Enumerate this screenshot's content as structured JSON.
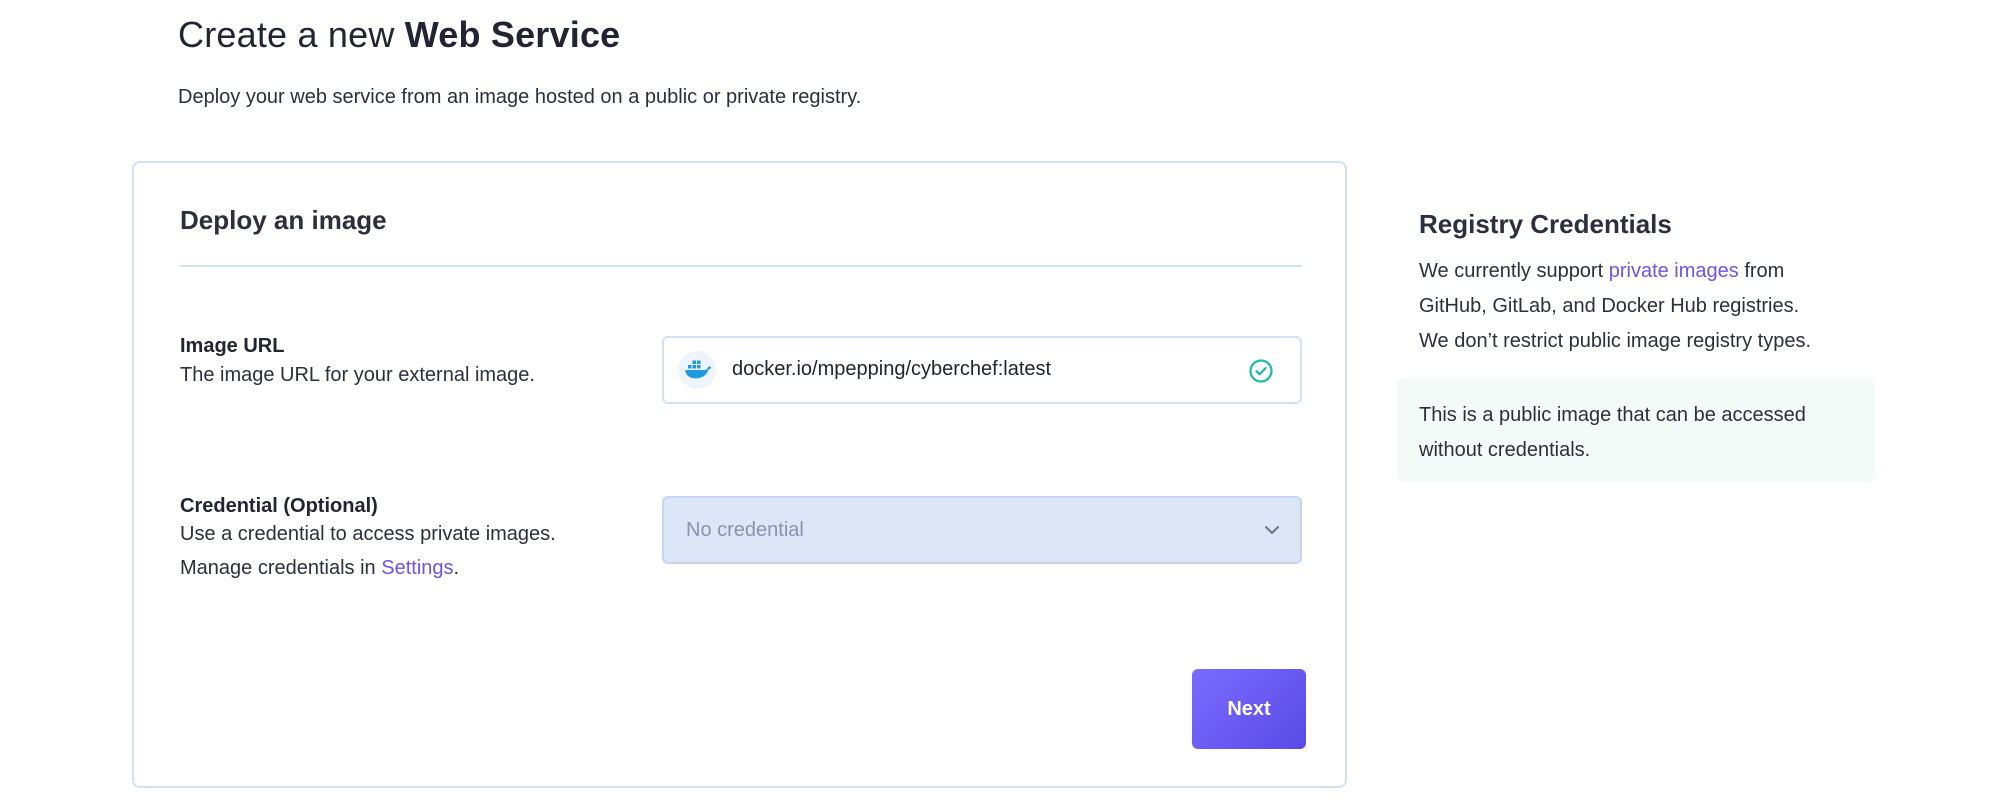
{
  "header": {
    "title_prefix": "Create a new",
    "title_bold": "Web Service",
    "subtitle": "Deploy your web service from an image hosted on a public or private registry."
  },
  "card": {
    "title": "Deploy an image",
    "image_url": {
      "label": "Image URL",
      "help": "The image URL for your external image.",
      "value": "docker.io/mpepping/cyberchef:latest",
      "icon": "docker-icon",
      "status_icon": "check-circle-icon"
    },
    "credential": {
      "label": "Credential (Optional)",
      "help_line1": "Use a credential to access private images.",
      "help_line2_prefix": "Manage credentials in",
      "settings_link": "Settings",
      "help_line2_suffix": ".",
      "selected": "No credential",
      "icon": "chevron-down-icon"
    },
    "next_label": "Next"
  },
  "sidebar": {
    "title": "Registry Credentials",
    "line1_prefix": "We currently support",
    "private_images_link": "private images",
    "line1_suffix": "from",
    "line2": "GitHub, GitLab, and Docker Hub registries.",
    "line3": "We don’t restrict public image registry types.",
    "note_line1": "This is a public image that can be accessed",
    "note_line2": "without credentials."
  },
  "colors": {
    "accent": "#6a55ea",
    "success": "#20b8a8",
    "docker": "#1d9bde",
    "border": "#d3e2f1"
  }
}
